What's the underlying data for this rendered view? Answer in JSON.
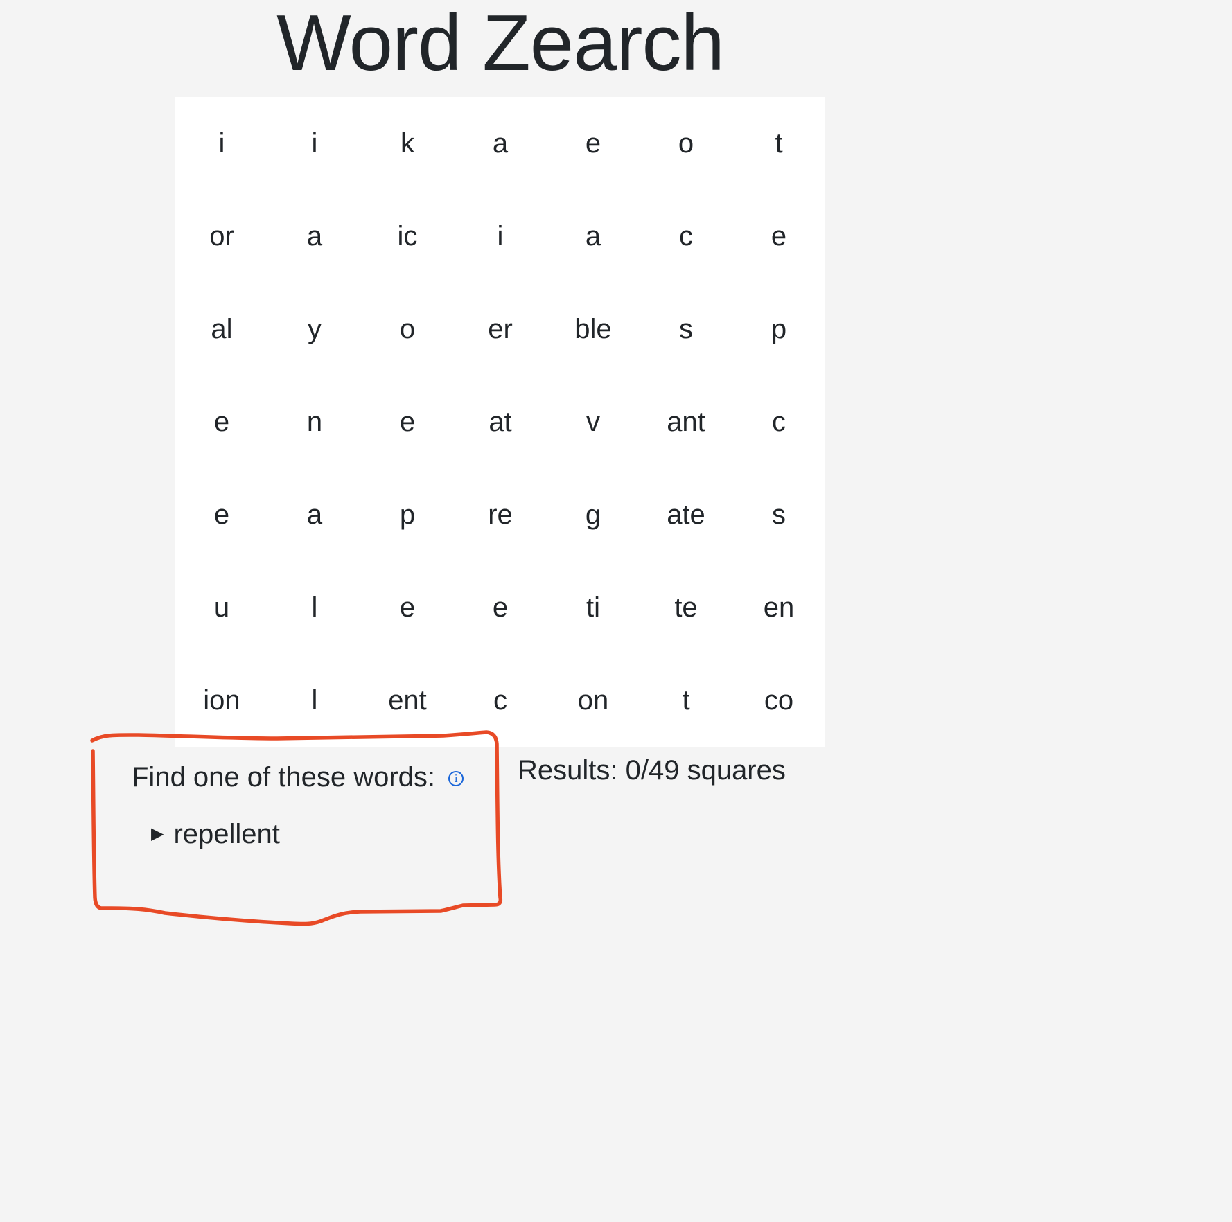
{
  "title": "Word Zearch",
  "grid": [
    [
      "i",
      "i",
      "k",
      "a",
      "e",
      "o",
      "t"
    ],
    [
      "or",
      "a",
      "ic",
      "i",
      "a",
      "c",
      "e"
    ],
    [
      "al",
      "y",
      "o",
      "er",
      "ble",
      "s",
      "p"
    ],
    [
      "e",
      "n",
      "e",
      "at",
      "v",
      "ant",
      "c"
    ],
    [
      "e",
      "a",
      "p",
      "re",
      "g",
      "ate",
      "s"
    ],
    [
      "u",
      "l",
      "e",
      "e",
      "ti",
      "te",
      "en"
    ],
    [
      "ion",
      "l",
      "ent",
      "c",
      "on",
      "t",
      "co"
    ]
  ],
  "find_panel": {
    "label": "Find one of these words:",
    "info_icon": "info-icon",
    "info_glyph": "i",
    "words": [
      "repellent"
    ],
    "expand_glyph": "▶"
  },
  "results": {
    "text": "Results: 0/49 squares",
    "found": 0,
    "total": 49
  },
  "colors": {
    "background": "#f4f4f4",
    "board": "#ffffff",
    "text": "#212529",
    "link": "#1a66d9",
    "annotation": "#e84a26"
  }
}
